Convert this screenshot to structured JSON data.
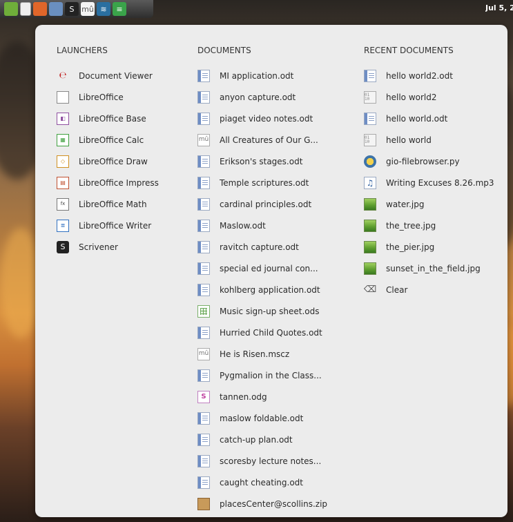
{
  "panel": {
    "clock": "Jul 5, 2",
    "launchers": [
      {
        "name": "files-icon",
        "glyph": "",
        "bg": "#6fae3a"
      },
      {
        "name": "document-icon",
        "glyph": "",
        "bg": "#eeeeee"
      },
      {
        "name": "firefox-icon",
        "glyph": "",
        "bg": "#e0662a"
      },
      {
        "name": "finder-icon",
        "glyph": "",
        "bg": "#6a8fbf"
      },
      {
        "name": "scrivener-icon",
        "glyph": "S",
        "bg": "#222222"
      },
      {
        "name": "musescore-icon",
        "glyph": "mû",
        "bg": "#f4f4f4"
      },
      {
        "name": "world-icon",
        "glyph": "≋",
        "bg": "#2a6fa0"
      },
      {
        "name": "spotify-icon",
        "glyph": "≡",
        "bg": "#3aa34a"
      }
    ]
  },
  "launchers": {
    "heading": "LAUNCHERS",
    "items": [
      {
        "label": "Document Viewer",
        "icon": "pdf",
        "glyph": "℮"
      },
      {
        "label": "LibreOffice",
        "icon": "lo",
        "glyph": ""
      },
      {
        "label": "LibreOffice Base",
        "icon": "lo-base",
        "glyph": "◧"
      },
      {
        "label": "LibreOffice Calc",
        "icon": "lo-calc",
        "glyph": "▦"
      },
      {
        "label": "LibreOffice Draw",
        "icon": "lo-draw",
        "glyph": "◇"
      },
      {
        "label": "LibreOffice Impress",
        "icon": "lo-imp",
        "glyph": "▤"
      },
      {
        "label": "LibreOffice Math",
        "icon": "lo-math",
        "glyph": "fx"
      },
      {
        "label": "LibreOffice Writer",
        "icon": "lo-wri",
        "glyph": "≣"
      },
      {
        "label": "Scrivener",
        "icon": "scriv",
        "glyph": "S"
      }
    ]
  },
  "documents": {
    "heading": "DOCUMENTS",
    "items": [
      {
        "label": "MI application.odt",
        "icon": "doc",
        "glyph": ""
      },
      {
        "label": "anyon capture.odt",
        "icon": "doc",
        "glyph": ""
      },
      {
        "label": "piaget video notes.odt",
        "icon": "doc",
        "glyph": ""
      },
      {
        "label": "All Creatures of Our G...",
        "icon": "mscz",
        "glyph": "mû"
      },
      {
        "label": "Erikson's stages.odt",
        "icon": "doc",
        "glyph": ""
      },
      {
        "label": "Temple scriptures.odt",
        "icon": "doc",
        "glyph": ""
      },
      {
        "label": "cardinal principles.odt",
        "icon": "doc",
        "glyph": ""
      },
      {
        "label": "Maslow.odt",
        "icon": "doc",
        "glyph": ""
      },
      {
        "label": "ravitch capture.odt",
        "icon": "doc",
        "glyph": ""
      },
      {
        "label": "special ed journal con...",
        "icon": "doc",
        "glyph": ""
      },
      {
        "label": "kohlberg application.odt",
        "icon": "doc",
        "glyph": ""
      },
      {
        "label": "Music sign-up sheet.ods",
        "icon": "ods",
        "glyph": ""
      },
      {
        "label": "Hurried Child Quotes.odt",
        "icon": "doc",
        "glyph": ""
      },
      {
        "label": "He is Risen.mscz",
        "icon": "mscz",
        "glyph": "mû"
      },
      {
        "label": "Pygmalion in the Class...",
        "icon": "doc",
        "glyph": ""
      },
      {
        "label": "tannen.odg",
        "icon": "odg",
        "glyph": "S"
      },
      {
        "label": "maslow foldable.odt",
        "icon": "doc",
        "glyph": ""
      },
      {
        "label": "catch-up plan.odt",
        "icon": "doc",
        "glyph": ""
      },
      {
        "label": "scoresby lecture notes...",
        "icon": "doc",
        "glyph": ""
      },
      {
        "label": "caught cheating.odt",
        "icon": "doc",
        "glyph": ""
      },
      {
        "label": "placesCenter@scollins.zip",
        "icon": "zip",
        "glyph": ""
      }
    ]
  },
  "recent": {
    "heading": "RECENT DOCUMENTS",
    "items": [
      {
        "label": "hello world2.odt",
        "icon": "doc",
        "glyph": ""
      },
      {
        "label": "hello world2",
        "icon": "bin",
        "glyph": "01 10"
      },
      {
        "label": "hello world.odt",
        "icon": "doc",
        "glyph": ""
      },
      {
        "label": "hello world",
        "icon": "bin",
        "glyph": "01 10"
      },
      {
        "label": "gio-filebrowser.py",
        "icon": "py",
        "glyph": ""
      },
      {
        "label": "Writing Excuses 8.26.mp3",
        "icon": "mp3",
        "glyph": "♫"
      },
      {
        "label": "water.jpg",
        "icon": "jpg",
        "glyph": ""
      },
      {
        "label": "the_tree.jpg",
        "icon": "jpg",
        "glyph": ""
      },
      {
        "label": "the_pier.jpg",
        "icon": "jpg",
        "glyph": ""
      },
      {
        "label": "sunset_in_the_field.jpg",
        "icon": "jpg",
        "glyph": ""
      },
      {
        "label": "Clear",
        "icon": "clear",
        "glyph": "⌫"
      }
    ]
  }
}
